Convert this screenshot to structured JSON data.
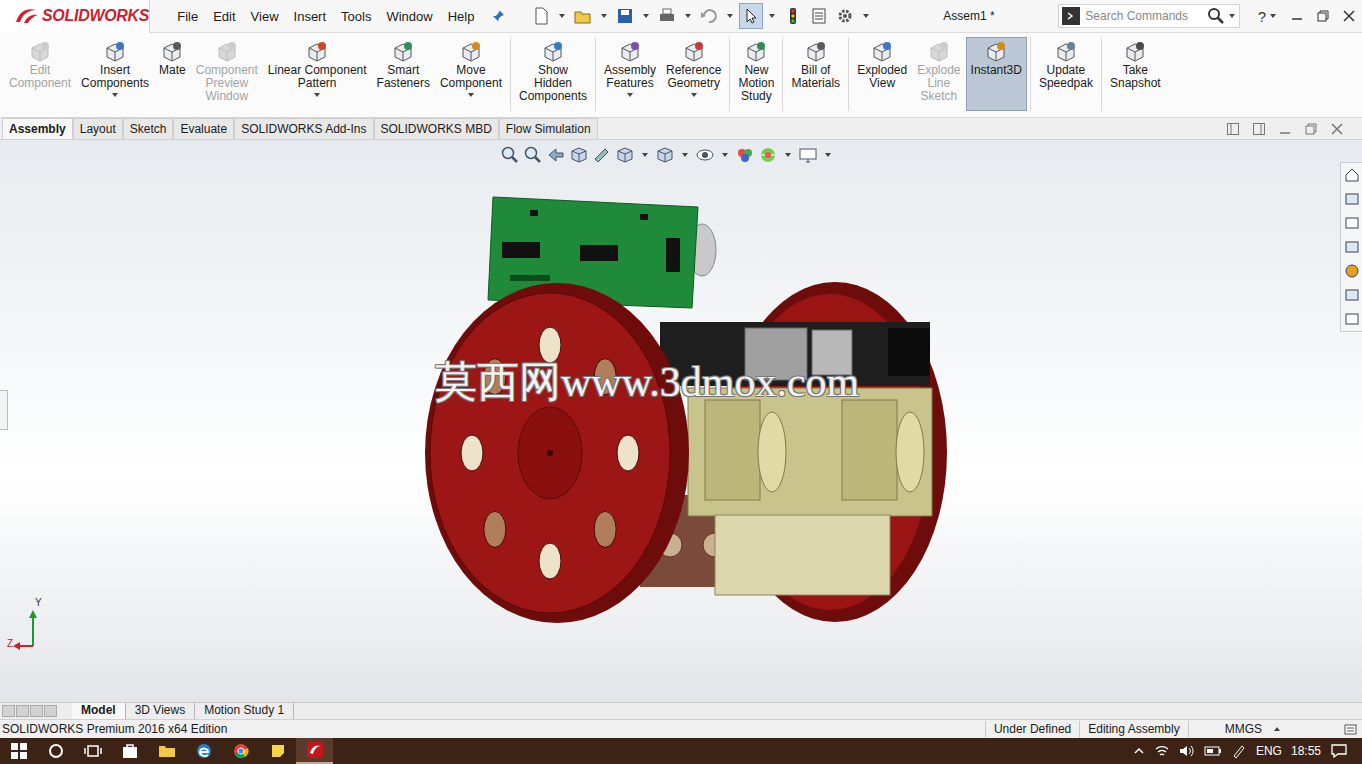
{
  "app": {
    "brand": "SOLIDWORKS"
  },
  "menu": [
    "File",
    "Edit",
    "View",
    "Insert",
    "Tools",
    "Window",
    "Help"
  ],
  "quick_tools": [
    {
      "selected": false
    },
    {
      "selected": false
    },
    {
      "selected": false
    },
    {
      "selected": false
    },
    {
      "selected": false
    },
    {
      "selected": true
    },
    {
      "selected": false
    },
    {
      "selected": false
    },
    {
      "selected": false
    }
  ],
  "window": {
    "title": "Assem1 *"
  },
  "search": {
    "placeholder": "Search Commands"
  },
  "help": "?",
  "ribbon": [
    [
      {
        "lines": [
          "Edit",
          "Component"
        ],
        "disabled": true,
        "selected": false,
        "dropdown": false
      },
      {
        "lines": [
          "Insert",
          "Components"
        ],
        "disabled": false,
        "selected": false,
        "dropdown": true
      },
      {
        "lines": [
          "Mate"
        ],
        "disabled": false,
        "selected": false,
        "dropdown": false
      },
      {
        "lines": [
          "Component",
          "Preview",
          "Window"
        ],
        "disabled": true,
        "selected": false,
        "dropdown": false
      },
      {
        "lines": [
          "Linear Component",
          "Pattern"
        ],
        "disabled": false,
        "selected": false,
        "dropdown": true
      },
      {
        "lines": [
          "Smart",
          "Fasteners"
        ],
        "disabled": false,
        "selected": false,
        "dropdown": false
      },
      {
        "lines": [
          "Move",
          "Component"
        ],
        "disabled": false,
        "selected": false,
        "dropdown": true
      }
    ],
    [
      {
        "lines": [
          "Show",
          "Hidden",
          "Components"
        ],
        "disabled": false,
        "selected": false,
        "dropdown": false
      }
    ],
    [
      {
        "lines": [
          "Assembly",
          "Features"
        ],
        "disabled": false,
        "selected": false,
        "dropdown": true
      },
      {
        "lines": [
          "Reference",
          "Geometry"
        ],
        "disabled": false,
        "selected": false,
        "dropdown": true
      }
    ],
    [
      {
        "lines": [
          "New",
          "Motion",
          "Study"
        ],
        "disabled": false,
        "selected": false,
        "dropdown": false
      }
    ],
    [
      {
        "lines": [
          "Bill of",
          "Materials"
        ],
        "disabled": false,
        "selected": false,
        "dropdown": false
      }
    ],
    [
      {
        "lines": [
          "Exploded",
          "View"
        ],
        "disabled": false,
        "selected": false,
        "dropdown": false
      },
      {
        "lines": [
          "Explode",
          "Line",
          "Sketch"
        ],
        "disabled": true,
        "selected": false,
        "dropdown": false
      },
      {
        "lines": [
          "Instant3D"
        ],
        "disabled": false,
        "selected": true,
        "dropdown": false
      }
    ],
    [
      {
        "lines": [
          "Update",
          "Speedpak"
        ],
        "disabled": false,
        "selected": false,
        "dropdown": false
      }
    ],
    [
      {
        "lines": [
          "Take",
          "Snapshot"
        ],
        "disabled": false,
        "selected": false,
        "dropdown": false
      }
    ]
  ],
  "tabs": [
    {
      "label": "Assembly",
      "selected": true
    },
    {
      "label": "Layout",
      "selected": false
    },
    {
      "label": "Sketch",
      "selected": false
    },
    {
      "label": "Evaluate",
      "selected": false
    },
    {
      "label": "SOLIDWORKS Add-Ins",
      "selected": false
    },
    {
      "label": "SOLIDWORKS MBD",
      "selected": false
    },
    {
      "label": "Flow Simulation",
      "selected": false
    }
  ],
  "watermark": "莫西网www.3dmox.com",
  "triad": {
    "up": "Y",
    "side": "Z"
  },
  "model_tabs": [
    {
      "label": "Model",
      "selected": true
    },
    {
      "label": "3D Views",
      "selected": false
    },
    {
      "label": "Motion Study 1",
      "selected": false
    }
  ],
  "status_bar": {
    "edition": "SOLIDWORKS Premium 2016 x64 Edition",
    "items": [
      "Under Defined",
      "Editing Assembly"
    ],
    "units": "MMGS"
  },
  "taskbar": {
    "language": "ENG",
    "time": "18:55"
  }
}
